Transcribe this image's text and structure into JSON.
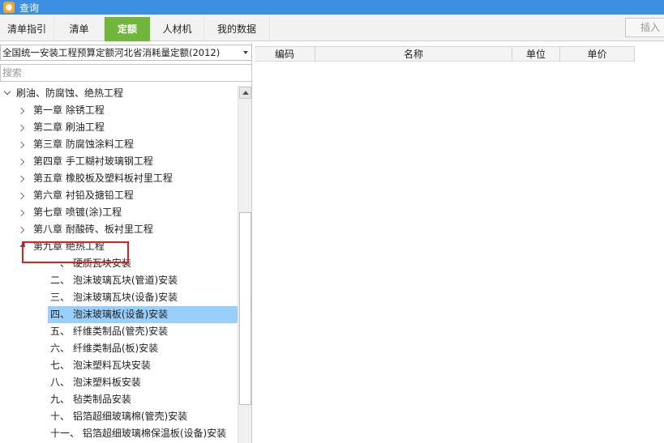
{
  "window": {
    "title": "查询"
  },
  "tabs": [
    {
      "label": "清单指引"
    },
    {
      "label": "清单"
    },
    {
      "label": "定额",
      "active": true
    },
    {
      "label": "人材机"
    },
    {
      "label": "我的数据"
    }
  ],
  "toolbar": {
    "insert_label": "插入"
  },
  "left_panel": {
    "quota_library": {
      "value": "全国统一安装工程预算定额河北省消耗量定额(2012)"
    },
    "search": {
      "placeholder": "搜索"
    },
    "tree": {
      "root": {
        "label": "刷油、防腐蚀、绝热工程",
        "expanded": true
      },
      "chapters": [
        {
          "label": "第一章 除锈工程"
        },
        {
          "label": "第二章 刷油工程"
        },
        {
          "label": "第三章 防腐蚀涂料工程"
        },
        {
          "label": "第四章 手工糊衬玻璃钢工程"
        },
        {
          "label": "第五章 橡胶板及塑料板衬里工程"
        },
        {
          "label": "第六章 衬铅及搪铅工程"
        },
        {
          "label": "第七章 喷镀(涂)工程"
        },
        {
          "label": "第八章 耐酸砖、板衬里工程"
        },
        {
          "label": "第九章 绝热工程",
          "expanded": true,
          "highlighted": true
        }
      ],
      "sections": [
        {
          "label": "一、 硬质瓦块安装"
        },
        {
          "label": "二、 泡沫玻璃瓦块(管道)安装"
        },
        {
          "label": "三、 泡沫玻璃瓦块(设备)安装"
        },
        {
          "label": "四、 泡沫玻璃板(设备)安装",
          "selected": true
        },
        {
          "label": "五、 纤维类制品(管壳)安装"
        },
        {
          "label": "六、 纤维类制品(板)安装"
        },
        {
          "label": "七、 泡沫塑料瓦块安装"
        },
        {
          "label": "八、 泡沫塑料板安装"
        },
        {
          "label": "九、 毡类制品安装"
        },
        {
          "label": "十、 铝箔超细玻璃棉(管壳)安装"
        },
        {
          "label": "十一、 铝箔超细玻璃棉保温板(设备)安装"
        }
      ]
    }
  },
  "table": {
    "columns": [
      "编码",
      "名称",
      "单位",
      "单价"
    ],
    "rows": []
  },
  "colors": {
    "titlebar": "#3d8fe2",
    "active_tab": "#6fb63a",
    "selected_row": "#99d0fb",
    "annotation_box": "#e02020"
  }
}
